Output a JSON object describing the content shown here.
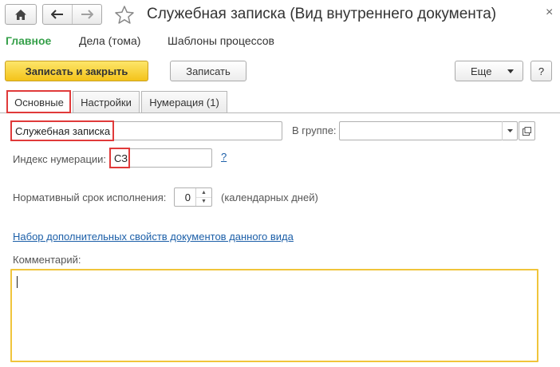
{
  "window": {
    "title": "Служебная записка (Вид внутреннего документа)",
    "close_glyph": "×"
  },
  "sections": [
    {
      "label": "Главное",
      "active": true
    },
    {
      "label": "Дела (тома)",
      "active": false
    },
    {
      "label": "Шаблоны процессов",
      "active": false
    }
  ],
  "toolbar": {
    "save_close_label": "Записать и закрыть",
    "save_label": "Записать",
    "more_label": "Еще",
    "help_label": "?"
  },
  "tabs": [
    {
      "label": "Основные",
      "active": true
    },
    {
      "label": "Настройки",
      "active": false
    },
    {
      "label": "Нумерация (1)",
      "active": false
    }
  ],
  "form": {
    "name_value": "Служебная записка",
    "group_label": "В группе:",
    "group_value": "",
    "index_label": "Индекс нумерации:",
    "index_value": "СЗ",
    "help_link": "?",
    "deadline_label": "Нормативный срок исполнения:",
    "deadline_value": "0",
    "deadline_unit": "(календарных дней)",
    "properties_link": "Набор дополнительных свойств документов данного вида",
    "comment_label": "Комментарий:",
    "comment_value": ""
  },
  "colors": {
    "accent_green": "#36a04a",
    "primary_yellow": "#f4c31a",
    "highlight_red": "#e03a3a",
    "link_blue": "#1c5fa8",
    "focus_yellow": "#f0c53b"
  }
}
